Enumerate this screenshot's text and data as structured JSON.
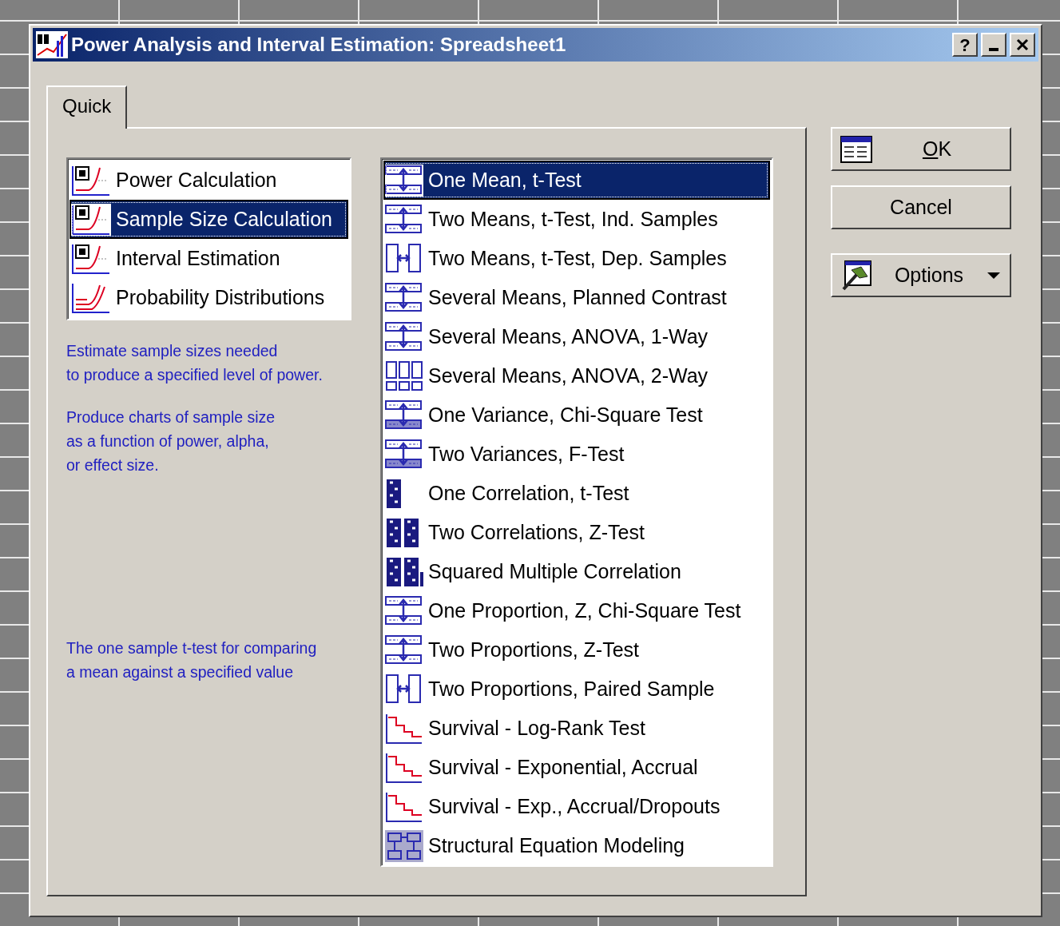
{
  "window": {
    "title": "Power Analysis and Interval Estimation: Spreadsheet1",
    "help_button": "?"
  },
  "tabs": [
    {
      "label": "Quick",
      "selected": true
    }
  ],
  "modes": [
    {
      "label": "Power Calculation",
      "selected": false
    },
    {
      "label": "Sample Size Calculation",
      "selected": true
    },
    {
      "label": "Interval Estimation",
      "selected": false
    },
    {
      "label": "Probability Distributions",
      "selected": false
    }
  ],
  "mode_description": [
    "Estimate sample sizes needed\nto produce a specified level of power.",
    "Produce charts of sample size\nas a function of power, alpha,\nor effect size."
  ],
  "analysis_description": "The one sample t-test for comparing\na mean against a specified value",
  "analyses": [
    {
      "label": "One Mean, t-Test",
      "selected": true
    },
    {
      "label": "Two Means, t-Test, Ind. Samples",
      "selected": false
    },
    {
      "label": "Two Means, t-Test, Dep. Samples",
      "selected": false
    },
    {
      "label": "Several Means, Planned Contrast",
      "selected": false
    },
    {
      "label": "Several Means, ANOVA, 1-Way",
      "selected": false
    },
    {
      "label": "Several Means, ANOVA, 2-Way",
      "selected": false
    },
    {
      "label": "One Variance, Chi-Square Test",
      "selected": false
    },
    {
      "label": "Two Variances, F-Test",
      "selected": false
    },
    {
      "label": "One Correlation, t-Test",
      "selected": false
    },
    {
      "label": "Two Correlations, Z-Test",
      "selected": false
    },
    {
      "label": "Squared Multiple Correlation",
      "selected": false
    },
    {
      "label": "One Proportion, Z, Chi-Square Test",
      "selected": false
    },
    {
      "label": "Two Proportions, Z-Test",
      "selected": false
    },
    {
      "label": "Two Proportions, Paired Sample",
      "selected": false
    },
    {
      "label": "Survival - Log-Rank Test",
      "selected": false
    },
    {
      "label": "Survival - Exponential, Accrual",
      "selected": false
    },
    {
      "label": "Survival - Exp., Accrual/Dropouts",
      "selected": false
    },
    {
      "label": "Structural Equation Modeling",
      "selected": false
    }
  ],
  "buttons": [
    {
      "kind": "ok",
      "label": "OK",
      "first_letter_underlined": true
    },
    {
      "kind": "cancel",
      "label": "Cancel"
    },
    {
      "kind": "options",
      "label": "Options"
    }
  ]
}
